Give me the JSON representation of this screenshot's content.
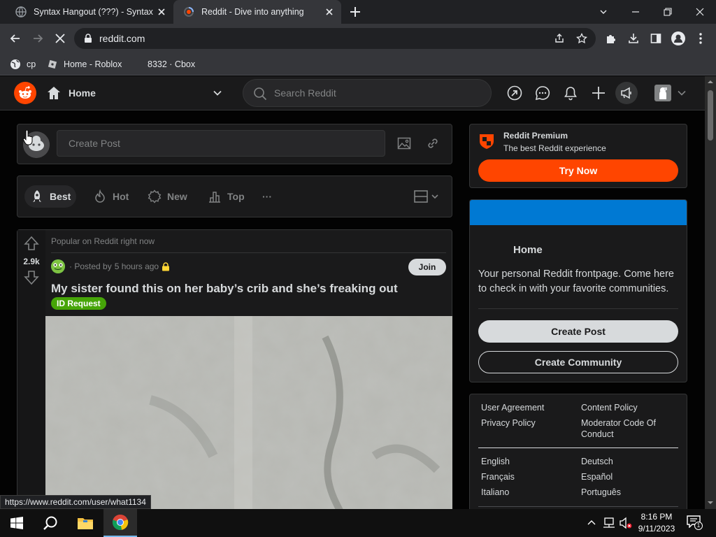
{
  "browser": {
    "tabs": [
      {
        "title": "Syntax Hangout (???) - Syntax",
        "active": false
      },
      {
        "title": "Reddit - Dive into anything",
        "active": true
      }
    ],
    "url": "reddit.com",
    "bookmarks": [
      {
        "label": "cp",
        "icon": "globe-icon"
      },
      {
        "label": "Home - Roblox",
        "icon": "roblox-icon"
      },
      {
        "label": "8332 · Cbox",
        "icon": ""
      }
    ],
    "status_url": "https://www.reddit.com/user/what1134"
  },
  "reddit": {
    "header": {
      "feed_label": "Home",
      "search_placeholder": "Search Reddit"
    },
    "create_post": {
      "placeholder": "Create Post"
    },
    "sort": {
      "options": [
        "Best",
        "Hot",
        "New",
        "Top"
      ],
      "active": "Best",
      "more": "···"
    },
    "post": {
      "section_label": "Popular on Reddit right now",
      "votes": "2.9k",
      "posted_by": "· Posted by",
      "time": "5 hours ago",
      "join_label": "Join",
      "title": "My sister found this on her baby’s crib and she’s freaking out",
      "flair": "ID Request",
      "flair_color": "#46a508"
    },
    "premium": {
      "title": "Reddit Premium",
      "subtitle": "The best Reddit experience",
      "button": "Try Now",
      "accent": "#ff4500"
    },
    "home_card": {
      "title": "Home",
      "description": "Your personal Reddit frontpage. Come here to check in with your favorite communities.",
      "create_post": "Create Post",
      "create_community": "Create Community",
      "banner_color": "#0079d3"
    },
    "footer": {
      "links_left": [
        "User Agreement",
        "Privacy Policy"
      ],
      "links_right": [
        "Content Policy",
        "Moderator Code Of Conduct"
      ],
      "languages_left": [
        "English",
        "Français",
        "Italiano"
      ],
      "languages_right": [
        "Deutsch",
        "Español",
        "Português"
      ]
    }
  },
  "taskbar": {
    "time": "8:16 PM",
    "date": "9/11/2023",
    "notification_count": "1"
  }
}
